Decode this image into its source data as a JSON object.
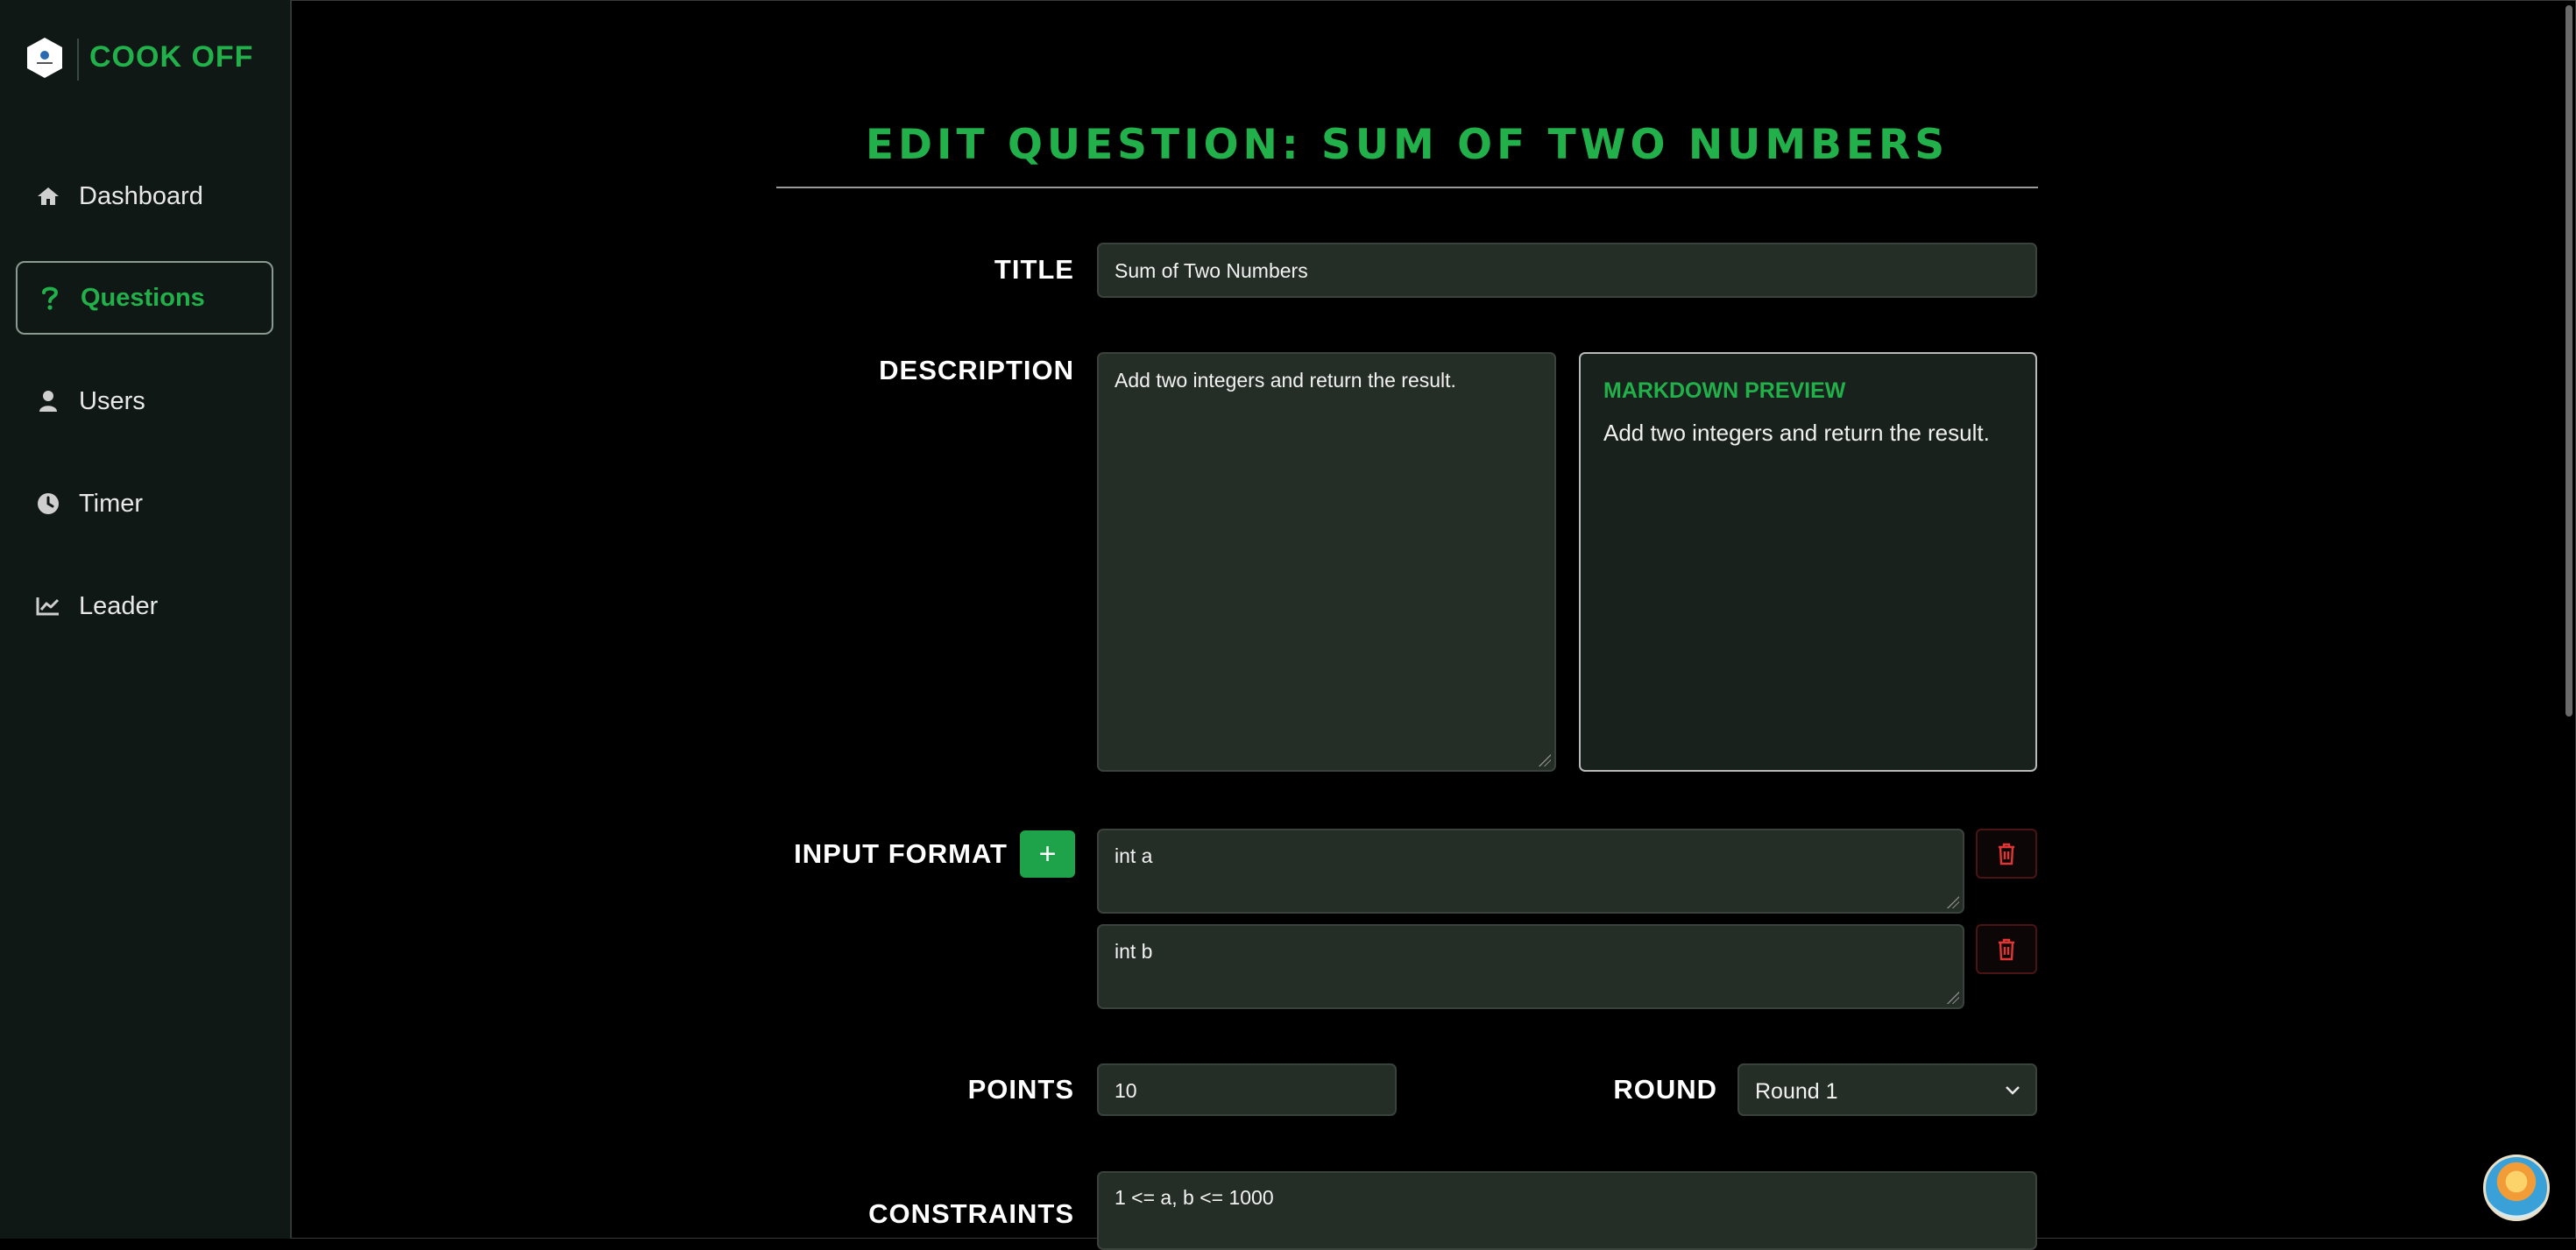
{
  "app": {
    "brand": "COOK OFF"
  },
  "sidebar": {
    "items": [
      {
        "label": "Dashboard",
        "icon": "home-icon"
      },
      {
        "label": "Questions",
        "icon": "question-icon",
        "active": true
      },
      {
        "label": "Users",
        "icon": "user-icon"
      },
      {
        "label": "Timer",
        "icon": "clock-icon"
      },
      {
        "label": "Leader",
        "icon": "chart-line-icon"
      }
    ]
  },
  "page": {
    "heading": "EDIT QUESTION: SUM OF TWO NUMBERS"
  },
  "form": {
    "title_label": "TITLE",
    "title_value": "Sum of Two Numbers",
    "description_label": "DESCRIPTION",
    "description_value": "Add two integers and return the result.",
    "preview_title": "MARKDOWN PREVIEW",
    "preview_body": "Add two integers and return the result.",
    "input_format_label": "INPUT FORMAT",
    "add_button_label": "+",
    "input_formats": [
      "int a",
      "int b"
    ],
    "points_label": "POINTS",
    "points_value": "10",
    "round_label": "ROUND",
    "round_value": "Round 1",
    "constraints_label": "CONSTRAINTS",
    "constraints_value": "1 <= a, b <= 1000"
  },
  "colors": {
    "accent": "#22b04b",
    "danger": "#e03535",
    "field_bg": "#252d27"
  }
}
